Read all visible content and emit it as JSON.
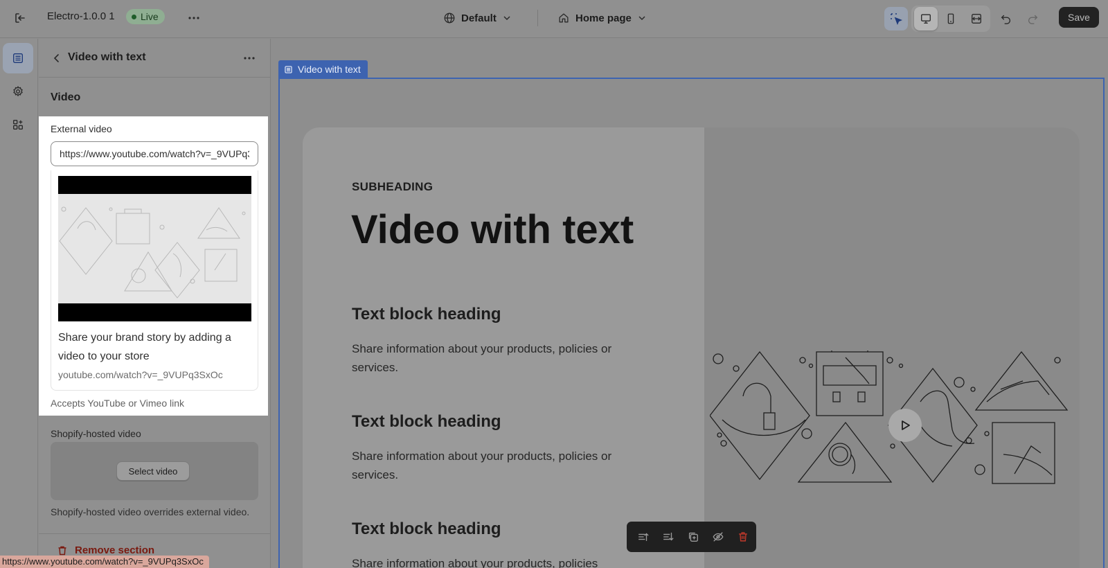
{
  "topbar": {
    "theme_name": "Electro-1.0.0 1",
    "live_badge": "Live",
    "template": "Default",
    "page": "Home page",
    "save_label": "Save"
  },
  "sidebar": {
    "title": "Video with text",
    "section_title": "Video",
    "external_video": {
      "label": "External video",
      "value": "https://www.youtube.com/watch?v=_9VUPq3SxOc",
      "preview_title": "Share your brand story by adding a video to your store",
      "preview_url": "youtube.com/watch?v=_9VUPq3SxOc",
      "help": "Accepts YouTube or Vimeo link"
    },
    "shopify_video": {
      "label": "Shopify-hosted video",
      "select_label": "Select video",
      "help": "Shopify-hosted video overrides external video."
    },
    "remove_label": "Remove section"
  },
  "status_bar": {
    "url": "https://www.youtube.com/watch?v=_9VUPq3SxOc"
  },
  "canvas": {
    "section_tag": "Video with text",
    "subheading": "SUBHEADING",
    "heading": "Video with text",
    "blocks": [
      {
        "heading": "Text block heading",
        "text": "Share information about your products, policies or services."
      },
      {
        "heading": "Text block heading",
        "text": "Share information about your products, policies or services."
      },
      {
        "heading": "Text block heading",
        "text": "Share information about your products, policies"
      }
    ]
  },
  "colors": {
    "accent": "#3d63b0",
    "live_dot": "#1f5d2a",
    "danger": "#c0392b"
  },
  "icons": {
    "exit": "exit-icon",
    "more": "more-horizontal-icon",
    "globe": "globe-icon",
    "home": "home-icon",
    "chevron": "chevron-down-icon",
    "inspector": "select-cursor-icon",
    "desktop": "desktop-icon",
    "mobile": "mobile-icon",
    "fullwidth": "fullwidth-icon",
    "undo": "undo-icon",
    "redo": "redo-icon",
    "sections": "sections-icon",
    "settings": "gear-icon",
    "apps": "apps-icon",
    "trash": "trash-icon",
    "play": "play-icon"
  }
}
